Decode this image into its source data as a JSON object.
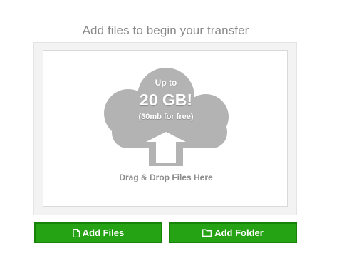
{
  "heading": "Add files to begin your transfer",
  "dropzone": {
    "up_to": "Up to",
    "size": "20 GB!",
    "free_note": "(30mb for free)",
    "drag_text": "Drag & Drop Files Here",
    "icons": [
      "cloud-icon",
      "upload-arrow-icon"
    ]
  },
  "buttons": {
    "add_files": {
      "label": "Add Files",
      "icon": "file-icon"
    },
    "add_folder": {
      "label": "Add Folder",
      "icon": "folder-icon"
    }
  },
  "colors": {
    "button_green": "#26a314",
    "button_border": "#178409",
    "cloud_gray": "#b3b3b3",
    "heading_text": "#8a8a8a"
  }
}
